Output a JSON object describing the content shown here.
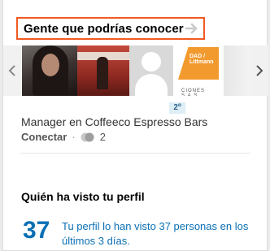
{
  "pymk": {
    "title": "Gente que podrías conocer",
    "connections_badge": "2º",
    "headline": "Manager en Coffeeco Espresso Bars",
    "connect_label": "Conectar",
    "separator": "·",
    "shared_connections": "2",
    "company_logo_text": "DAD / Littmann",
    "company_logo_caption": "CIONES S.A.S."
  },
  "wvmp": {
    "title": "Quién ha visto tu perfil",
    "count": "37",
    "description": "Tu perfil lo han visto 37 personas en los últimos 3 días."
  },
  "colors": {
    "accent_highlight": "#f15a22",
    "link": "#0a6fb5"
  },
  "icons": {
    "header_arrow": "arrow-right-icon",
    "prev": "chevron-left-icon",
    "next": "chevron-right-icon",
    "shared": "shared-connections-icon"
  }
}
